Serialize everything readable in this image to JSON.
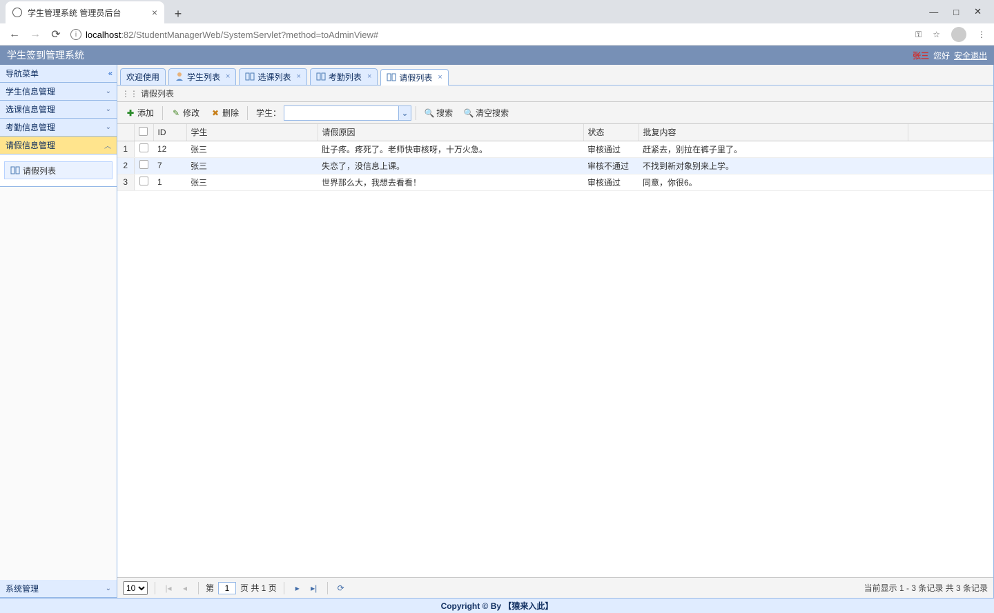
{
  "browser": {
    "tab_title": "学生管理系统 管理员后台",
    "url_host": "localhost",
    "url_port": ":82",
    "url_path": "/StudentManagerWeb/SystemServlet?method=toAdminView#"
  },
  "topbar": {
    "title": "学生签到管理系统",
    "user": "张三",
    "greeting": "您好",
    "logout": "安全退出"
  },
  "sidebar": {
    "title": "导航菜单",
    "items": [
      "学生信息管理",
      "选课信息管理",
      "考勤信息管理",
      "请假信息管理"
    ],
    "selected_index": 3,
    "tree_node": "请假列表",
    "bottom": "系统管理"
  },
  "tabs": [
    "欢迎使用",
    "学生列表",
    "选课列表",
    "考勤列表",
    "请假列表"
  ],
  "active_tab_index": 4,
  "panel_title": "请假列表",
  "toolbar": {
    "add": "添加",
    "edit": "修改",
    "delete": "删除",
    "student_label": "学生：",
    "search": "搜索",
    "clear_search": "清空搜索"
  },
  "columns": [
    "ID",
    "学生",
    "请假原因",
    "状态",
    "批复内容"
  ],
  "rows": [
    {
      "id": "12",
      "student": "张三",
      "reason": "肚子疼。疼死了。老师快审核呀，十万火急。",
      "status": "审核通过",
      "reply": "赶紧去，别拉在裤子里了。"
    },
    {
      "id": "7",
      "student": "张三",
      "reason": "失恋了，没信息上课。",
      "status": "审核不通过",
      "reply": "不找到新对象别来上学。"
    },
    {
      "id": "1",
      "student": "张三",
      "reason": "世界那么大，我想去看看！",
      "status": "审核通过",
      "reply": "同意，你很6。"
    }
  ],
  "pager": {
    "page_size": "10",
    "page_prefix": "第",
    "current_page": "1",
    "page_suffix": "页 共 1 页",
    "info": "当前显示 1 - 3 条记录 共 3 条记录"
  },
  "footer": "Copyright © By 【猿来入此】"
}
